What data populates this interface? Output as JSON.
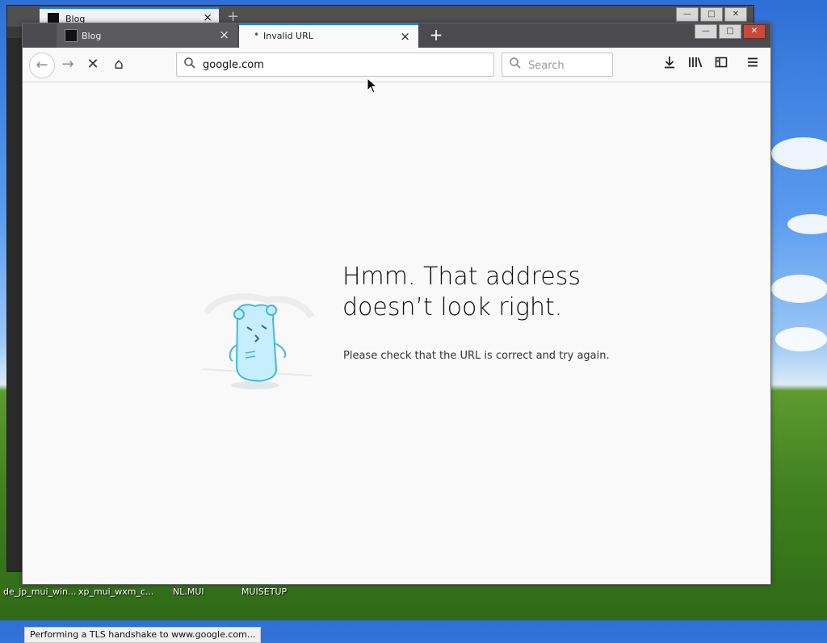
{
  "background_window": {
    "tab_title": "Blog",
    "close_icon": "×",
    "new_tab_icon": "+"
  },
  "tabs": [
    {
      "title": "Blog",
      "favicon": "blog-favicon-icon",
      "active": false
    },
    {
      "title": "Invalid URL",
      "active": true,
      "loading_dot": "•"
    }
  ],
  "tab_close_glyph": "×",
  "new_tab_glyph": "+",
  "window_controls": {
    "minimize": "—",
    "maximize": "□",
    "close": "✕"
  },
  "navbar": {
    "back_glyph": "←",
    "forward_glyph": "→",
    "stop_glyph": "✕",
    "home_glyph": "⌂",
    "url_value": "google.com",
    "search_placeholder": "Search",
    "search_glyph": "🔍",
    "download_glyph": "⤓",
    "library_glyph": "|||\\",
    "sidebar_glyph": "◫",
    "menu_glyph": "≡"
  },
  "error_page": {
    "title": "Hmm. That address doesn’t look right.",
    "description": "Please check that the URL is correct and try again."
  },
  "status_text": "Performing a TLS handshake to www.google.com...",
  "taskbar_items": [
    "de_jp_mui_win...",
    "xp_mui_wxm_c...",
    "NL.MUI",
    "MUISETUP"
  ],
  "colors": {
    "accent": "#0a84ff",
    "tabbar": "#4a4a4f",
    "page_bg": "#f9f9fa",
    "illustration": "#7fd1f0"
  }
}
